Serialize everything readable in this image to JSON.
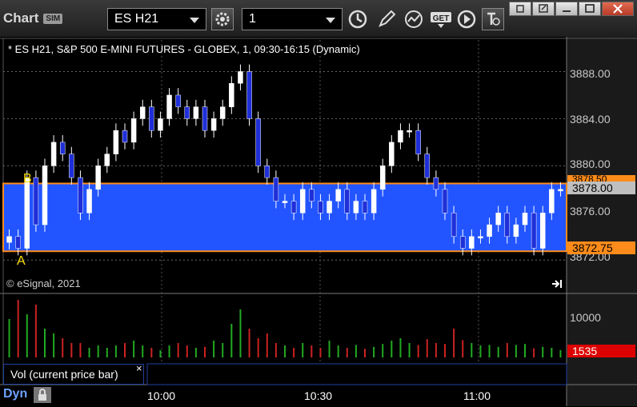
{
  "app": {
    "title": "Chart",
    "sim_badge": "SIM"
  },
  "toolbar": {
    "symbol": "ES H21",
    "interval": "1",
    "icons": [
      "gear-icon",
      "clock-icon",
      "pencil-icon",
      "study-icon",
      "get-icon",
      "play-icon",
      "text-icon"
    ]
  },
  "window_buttons": [
    "restore-icon",
    "popout-icon",
    "maximize-icon",
    "close-icon"
  ],
  "chart": {
    "title": "* ES H21, S&P 500 E-MINI FUTURES - GLOBEX, 1, 09:30-16:15 (Dynamic)",
    "copyright": "© eSignal, 2021",
    "price_labels": [
      "3888.00",
      "3884.00",
      "3880.00",
      "3876.00",
      "3872.00"
    ],
    "tags": {
      "top": "3878.50",
      "current": "3878.00",
      "bottom": "3872.75"
    },
    "markers": {
      "a": "A",
      "b": "B"
    },
    "colors": {
      "band": "#2255ff",
      "band_border": "#ff8c1a",
      "up": "#ffffff",
      "down": "#1f2fd8",
      "vol_up": "#22aa22",
      "vol_down": "#cc2222",
      "vol_tag": "#dd0000",
      "cur_tag": "#bfbfbf"
    }
  },
  "volume": {
    "label": "Vol (current price bar)",
    "scale_label": "10000",
    "current": "1535",
    "close": "×"
  },
  "time_axis": [
    "10:00",
    "10:30",
    "11:00"
  ],
  "footer": {
    "dyn": "Dyn"
  },
  "chart_data": {
    "type": "candlestick",
    "title": "* ES H21, S&P 500 E-MINI FUTURES - GLOBEX, 1, 09:30-16:15 (Dynamic)",
    "ylim": [
      3871,
      3890
    ],
    "band": [
      3872.75,
      3878.5
    ],
    "x_ticks": [
      "10:00",
      "10:30",
      "11:00"
    ],
    "closes": [
      3874,
      3873,
      3879,
      3875,
      3880,
      3882,
      3881,
      3879,
      3876,
      3878,
      3880,
      3881,
      3883,
      3882,
      3884,
      3885,
      3883,
      3884,
      3886,
      3885,
      3884,
      3885,
      3883,
      3884,
      3885,
      3887,
      3888,
      3884,
      3880,
      3879,
      3877,
      3877,
      3876,
      3878,
      3877,
      3876,
      3877,
      3878,
      3876,
      3877,
      3876,
      3878,
      3880,
      3882,
      3883,
      3883,
      3881,
      3879,
      3878,
      3876,
      3874,
      3873,
      3874,
      3874,
      3875,
      3876,
      3874,
      3875,
      3876,
      3873,
      3876,
      3878,
      3878
    ],
    "volumes": [
      8000,
      12000,
      9000,
      11000,
      6000,
      5000,
      4000,
      3000,
      3000,
      2000,
      2500,
      2000,
      2500,
      3000,
      3500,
      2500,
      2000,
      1500,
      2500,
      3000,
      2500,
      2000,
      2200,
      3500,
      3000,
      7000,
      10000,
      6000,
      4000,
      5000,
      3000,
      2500,
      2000,
      3000,
      2500,
      2000,
      3500,
      2500,
      2000,
      2600,
      1800,
      2200,
      2800,
      3500,
      4000,
      3000,
      2600,
      3800,
      3000,
      2800,
      6000,
      3600,
      3000,
      2500,
      2600,
      2200,
      3000,
      2600,
      2800,
      1900,
      2200,
      2000,
      1535
    ]
  }
}
